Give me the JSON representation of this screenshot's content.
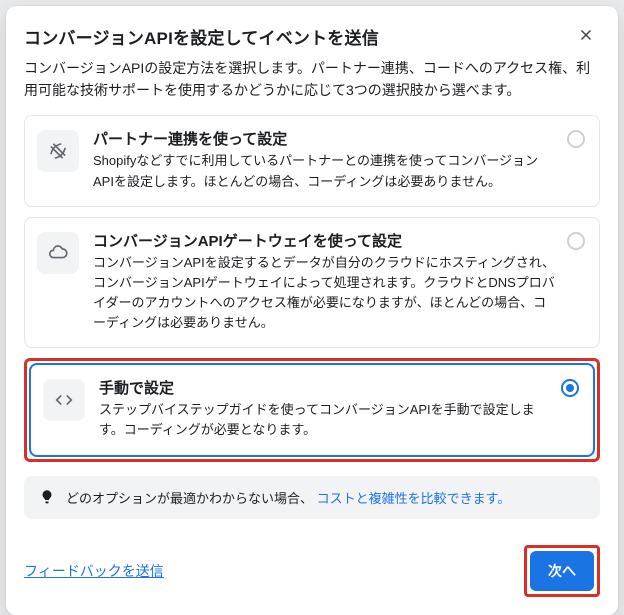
{
  "header": {
    "title": "コンバージョンAPIを設定してイベントを送信"
  },
  "intro": "コンバージョンAPIの設定方法を選択します。パートナー連携、コードへのアクセス権、利用可能な技術サポートを使用するかどうかに応じて3つの選択肢から選べます。",
  "options": [
    {
      "title": "パートナー連携を使って設定",
      "desc": "Shopifyなどすでに利用しているパートナーとの連携を使ってコンバージョンAPIを設定します。ほとんどの場合、コーディングは必要ありません。"
    },
    {
      "title": "コンバージョンAPIゲートウェイを使って設定",
      "desc": "コンバージョンAPIを設定するとデータが自分のクラウドにホスティングされ、コンバージョンAPIゲートウェイによって処理されます。クラウドとDNSプロバイダーのアカウントへのアクセス権が必要になりますが、ほとんどの場合、コーディングは必要ありません。"
    },
    {
      "title": "手動で設定",
      "desc": "ステップバイステップガイドを使ってコンバージョンAPIを手動で設定します。コーディングが必要となります。"
    }
  ],
  "info": {
    "text": "どのオプションが最適かわからない場合、",
    "link": "コストと複雑性を比較できます。"
  },
  "footer": {
    "feedback": "フィードバックを送信",
    "next": "次へ"
  }
}
